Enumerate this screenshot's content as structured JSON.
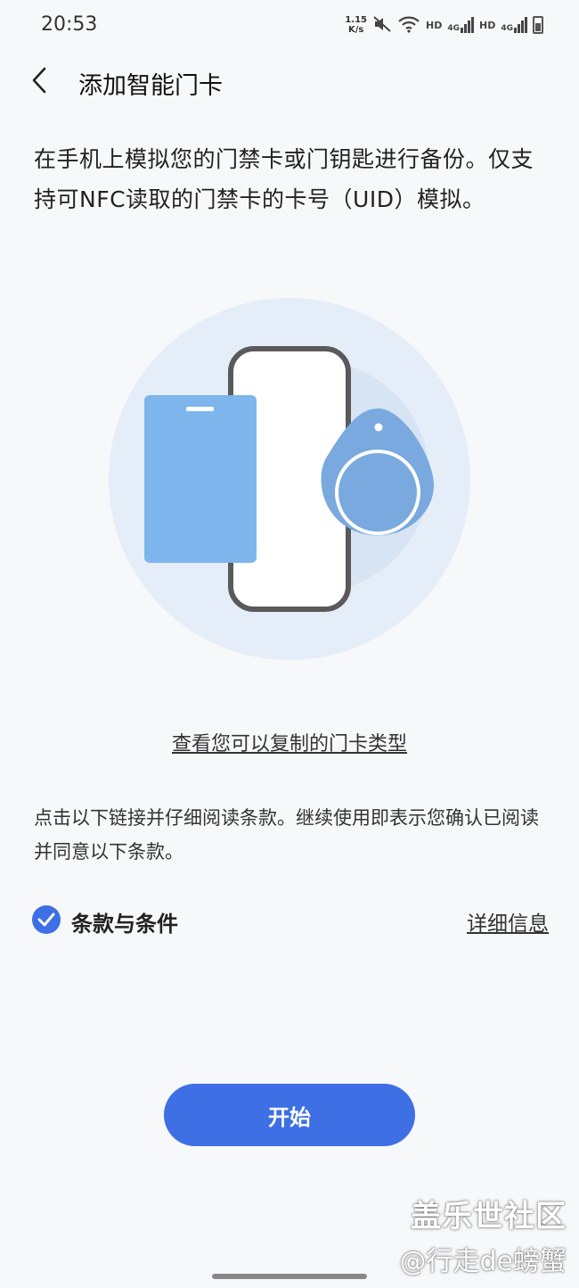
{
  "status_bar": {
    "time": "20:53",
    "net_speed_value": "1.15",
    "net_speed_unit": "K/s",
    "hd1": "HD",
    "net1": "4G",
    "hd2": "HD",
    "net2": "4G"
  },
  "header": {
    "title": "添加智能门卡"
  },
  "intro": {
    "text": "在手机上模拟您的门禁卡或门钥匙进行备份。仅支持可NFC读取的门禁卡的卡号（UID）模拟。"
  },
  "links": {
    "card_types": "查看您可以复制的门卡类型"
  },
  "terms": {
    "note": "点击以下链接并仔细阅读条款。继续使用即表示您确认已阅读并同意以下条款。",
    "label": "条款与条件",
    "details": "详细信息",
    "checked": true
  },
  "actions": {
    "start": "开始"
  },
  "watermark": {
    "line1": "盖乐世社区",
    "line2": "@行走de螃蟹"
  },
  "colors": {
    "accent": "#3e6fe4",
    "card": "#7db5ec",
    "tag": "#79a9df",
    "circle_bg": "#e5eef8"
  }
}
